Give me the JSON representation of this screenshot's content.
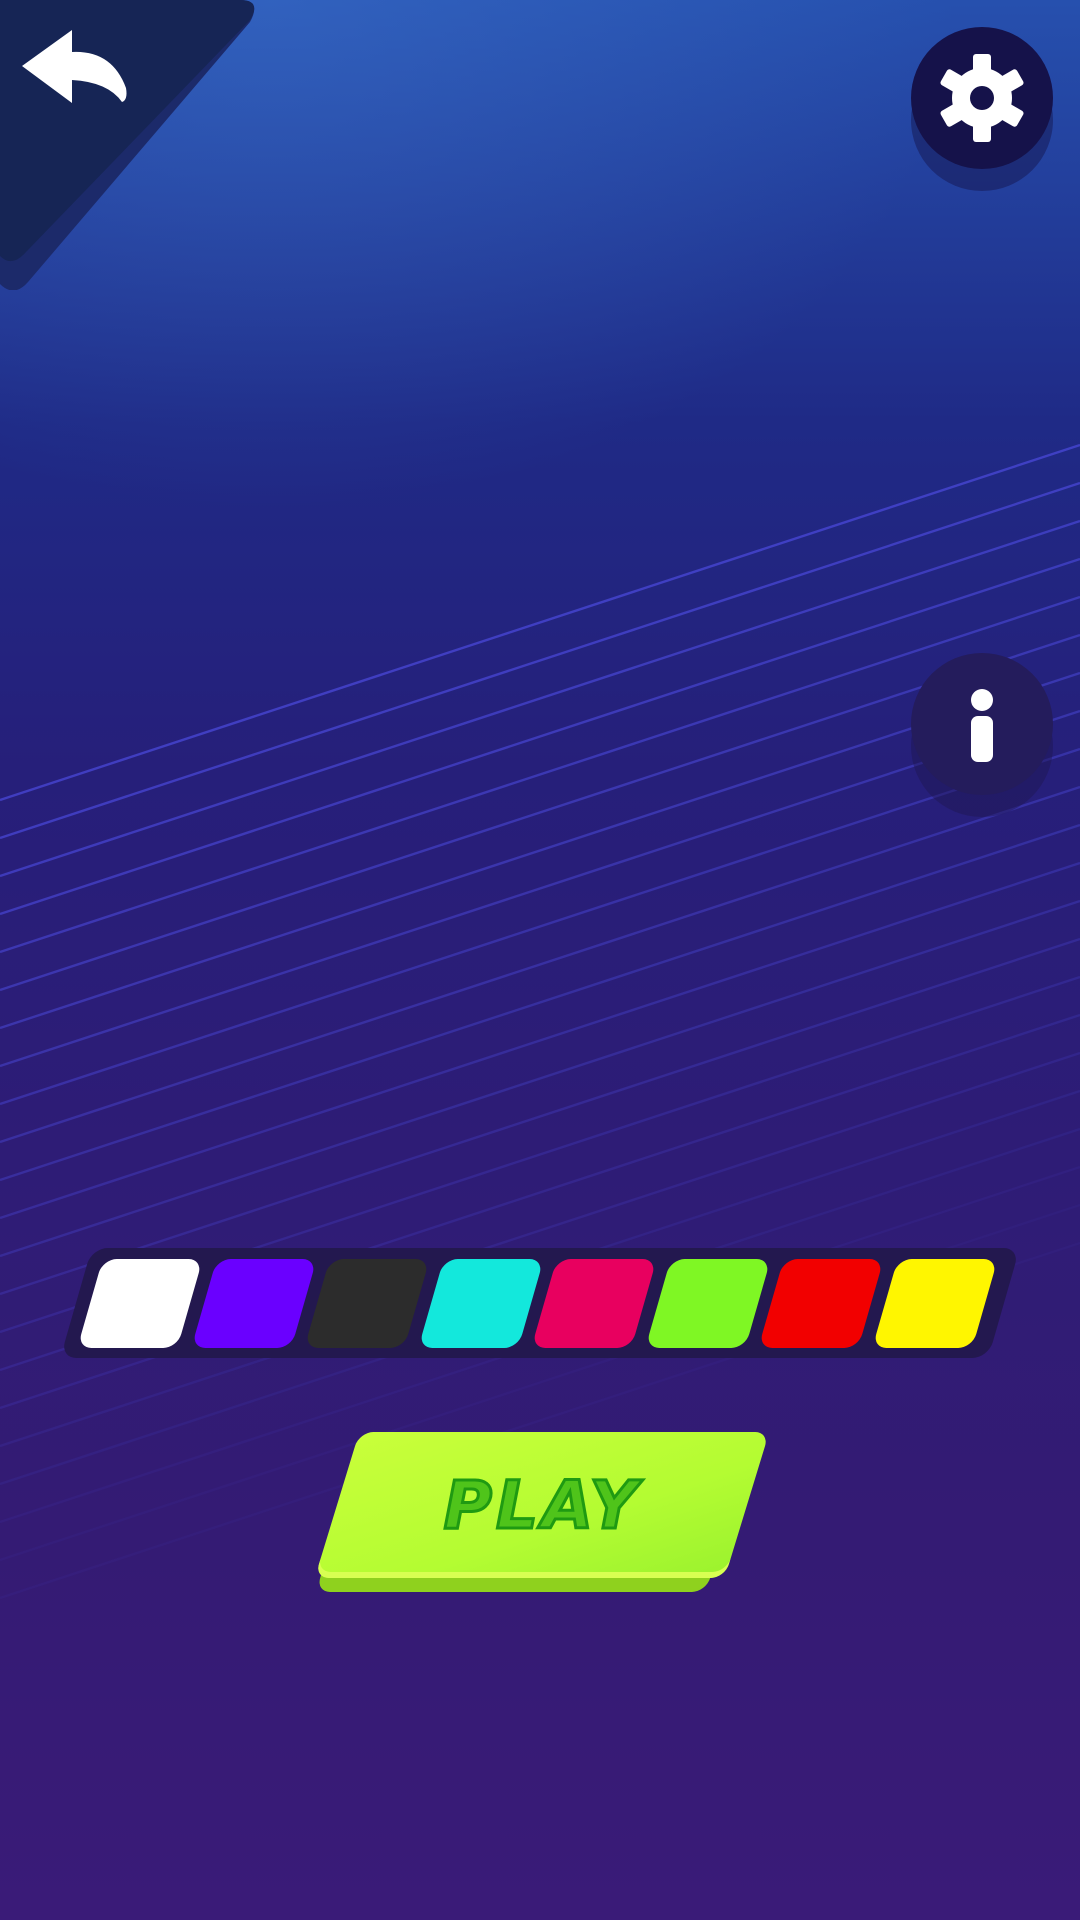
{
  "screen": "color-select",
  "buttons": {
    "back_icon": "back-arrow-icon",
    "settings_icon": "gear-icon",
    "info_icon": "info-icon"
  },
  "palette": {
    "swatches": [
      {
        "name": "white",
        "color": "#FFFFFF"
      },
      {
        "name": "purple",
        "color": "#6A00FF"
      },
      {
        "name": "dark-gray",
        "color": "#2C2C2C"
      },
      {
        "name": "cyan",
        "color": "#13E8DC"
      },
      {
        "name": "pink",
        "color": "#E8005F"
      },
      {
        "name": "green",
        "color": "#7FF724"
      },
      {
        "name": "red",
        "color": "#F20000"
      },
      {
        "name": "yellow",
        "color": "#FFF600"
      }
    ]
  },
  "play": {
    "label": "PLAY",
    "color": "#B8FD33"
  },
  "colors": {
    "background_top": "#2650AE",
    "background_bottom": "#3A1B78",
    "button_dark": "#15124A"
  }
}
